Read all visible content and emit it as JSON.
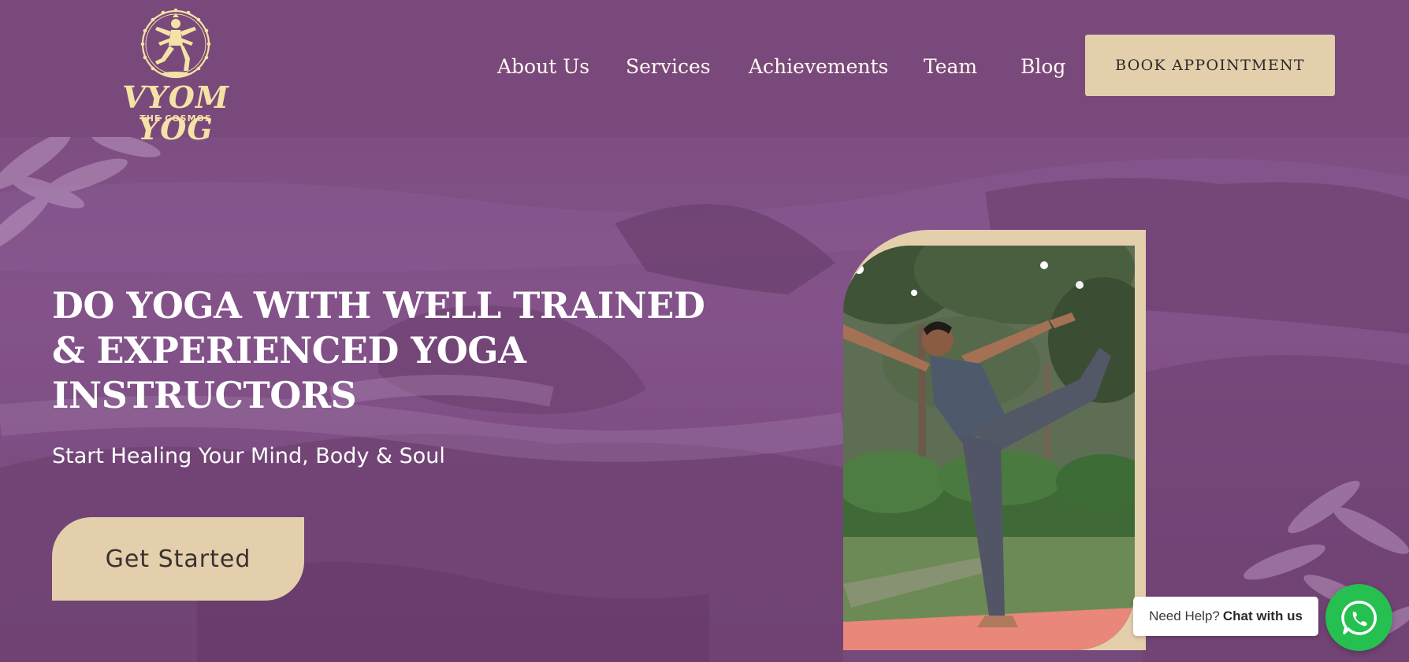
{
  "brand": {
    "name": "VYOM YOG",
    "tagline": "THE COSMOS"
  },
  "nav": {
    "items": [
      "About Us",
      "Services",
      "Achievements",
      "Team",
      "Blog"
    ],
    "cta": "BOOK APPOINTMENT"
  },
  "hero": {
    "headline": "DO YOGA WITH WELL TRAINED & EXPERIENCED YOGA INSTRUCTORS",
    "subheadline": "Start Healing Your Mind, Body & Soul",
    "cta": "Get Started"
  },
  "chat": {
    "prefix": "Need Help?",
    "action": "Chat with us"
  },
  "colors": {
    "header_bg": "#7a497b",
    "accent_beige": "#e4cfad",
    "logo_gold": "#f4e2a6",
    "whatsapp_green": "#25c04f"
  },
  "icons": [
    "dancing-deity-logo-icon",
    "whatsapp-icon"
  ]
}
